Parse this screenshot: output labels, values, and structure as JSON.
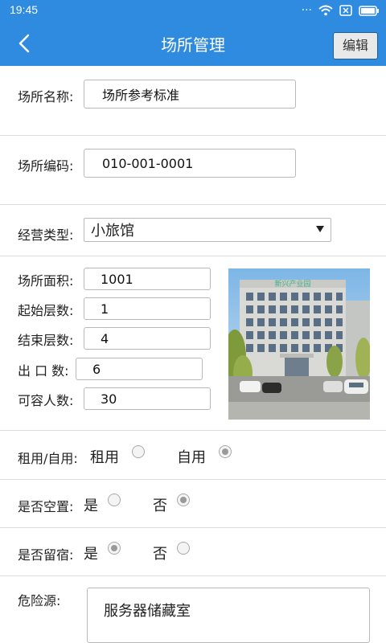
{
  "status_bar": {
    "time": "19:45",
    "icons": [
      "dots-icon",
      "wifi-icon",
      "sim-error-icon",
      "battery-icon"
    ]
  },
  "header": {
    "title": "场所管理",
    "edit_label": "编辑",
    "back_icon": "back-arrow-icon",
    "background": "#2e8bdf"
  },
  "form": {
    "name": {
      "label": "场所名称:",
      "value": "场所参考标准"
    },
    "code": {
      "label": "场所编码:",
      "value": "010-001-0001"
    },
    "business_type": {
      "label": "经营类型:",
      "value": "小旅馆"
    },
    "area": {
      "label": "场所面积:",
      "value": "1001"
    },
    "start_floor": {
      "label": "起始层数:",
      "value": "1"
    },
    "end_floor": {
      "label": "结束层数:",
      "value": "4"
    },
    "exits": {
      "label": "出 口 数:",
      "value": "6"
    },
    "capacity": {
      "label": "可容人数:",
      "value": "30"
    },
    "rent": {
      "label": "租用/自用:",
      "options": [
        {
          "label": "租用",
          "checked": false
        },
        {
          "label": "自用",
          "checked": true
        }
      ]
    },
    "vacant": {
      "label": "是否空置:",
      "options": [
        {
          "label": "是",
          "checked": false
        },
        {
          "label": "否",
          "checked": true
        }
      ]
    },
    "lodging": {
      "label": "是否留宿:",
      "options": [
        {
          "label": "是",
          "checked": true
        },
        {
          "label": "否",
          "checked": false
        }
      ]
    },
    "hazard": {
      "label": "危险源:",
      "value": "服务器储藏室"
    }
  },
  "photo": {
    "sign_text": "新兴产业园"
  }
}
